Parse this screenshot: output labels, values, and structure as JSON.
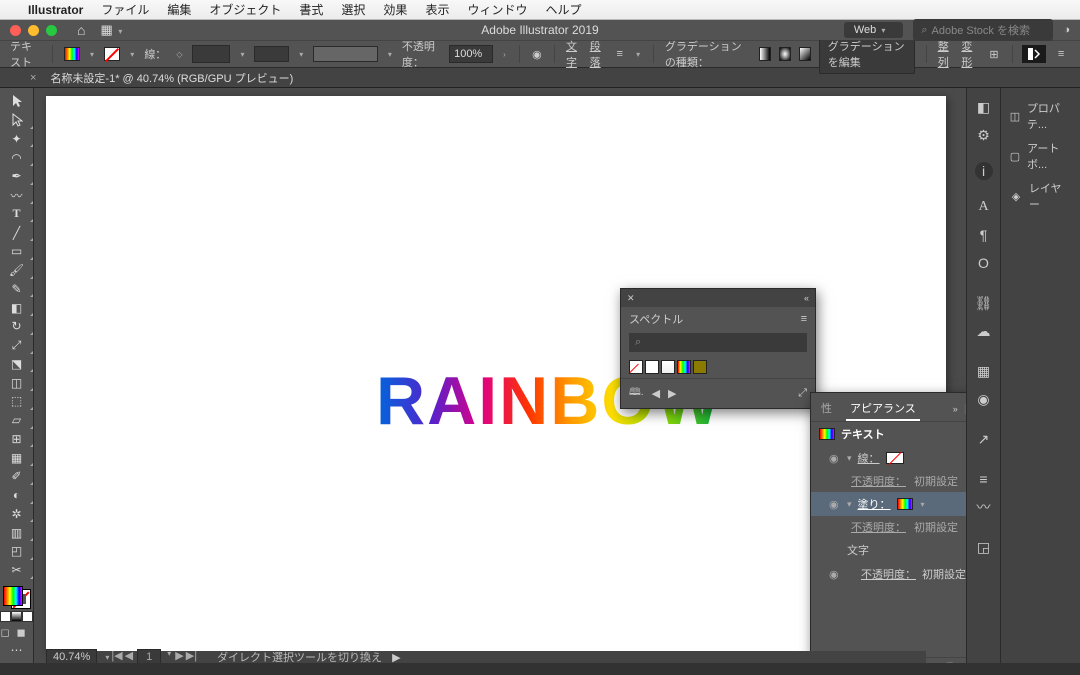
{
  "menubar": {
    "app": "Illustrator",
    "items": [
      "ファイル",
      "編集",
      "オブジェクト",
      "書式",
      "選択",
      "効果",
      "表示",
      "ウィンドウ",
      "ヘルプ"
    ]
  },
  "titlebar": {
    "title": "Adobe Illustrator 2019",
    "workspace_label": "Web",
    "search_placeholder": "Adobe Stock を検索"
  },
  "controlbar": {
    "selection_type": "テキスト",
    "stroke_label": "線：",
    "opacity_label": "不透明度：",
    "opacity_value": "100%",
    "char_label": "文字",
    "para_label": "段落",
    "grad_type_label": "グラデーションの種類：",
    "edit_grad_label": "グラデーションを編集",
    "align_label": "整列",
    "transform_label": "変形"
  },
  "tab": {
    "name": "名称未設定-1* @ 40.74% (RGB/GPU プレビュー)"
  },
  "artboard": {
    "text": "RAINBOW"
  },
  "swatch_panel": {
    "title": "スペクトル"
  },
  "appearance_panel": {
    "tab_hidden": "性",
    "tab_active": "アピアランス",
    "target": "テキスト",
    "stroke_label": "線：",
    "fill_label": "塗り：",
    "opacity_label": "不透明度：",
    "opacity_value": "初期設定",
    "char_label": "文字"
  },
  "right_panels": {
    "properties": "プロパテ...",
    "artboard": "アートボ...",
    "layers": "レイヤー"
  },
  "statusbar": {
    "zoom": "40.74%",
    "artboard_num": "1",
    "hint": "ダイレクト選択ツールを切り換え"
  }
}
